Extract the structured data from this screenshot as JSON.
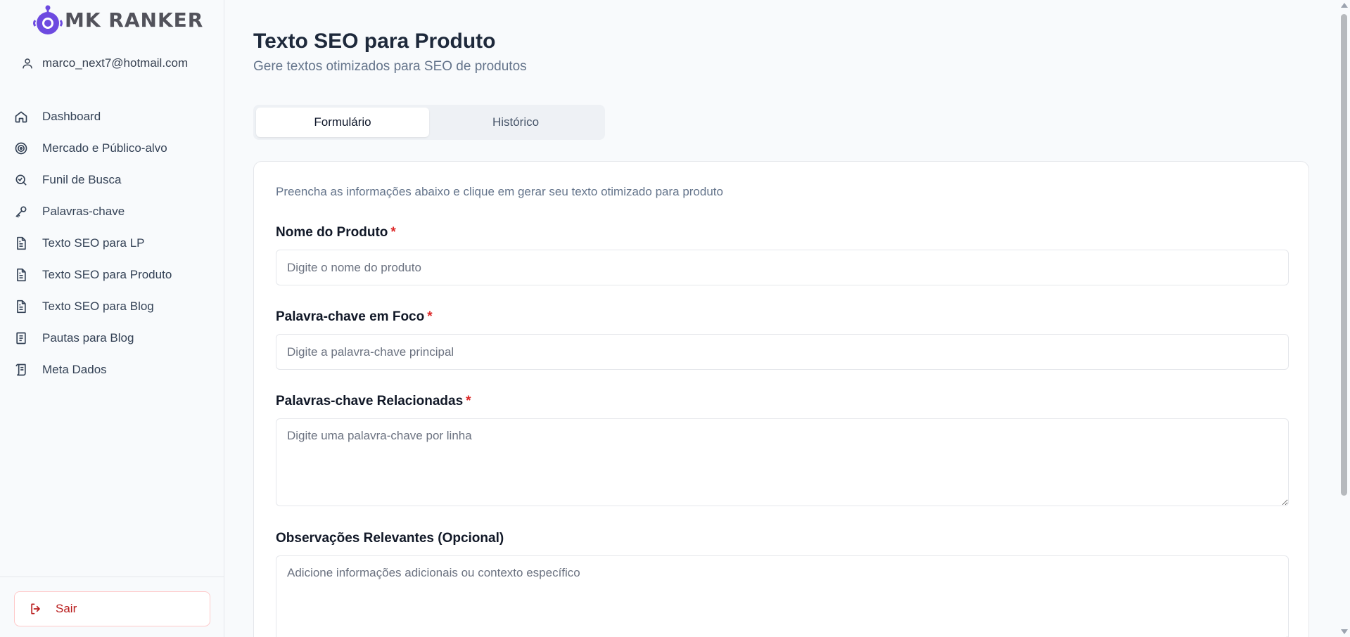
{
  "brand": {
    "name": "MK RANKER",
    "accent": "#6d4ae0"
  },
  "user": {
    "email": "marco_next7@hotmail.com",
    "icon": "user-icon"
  },
  "sidebar": {
    "items": [
      {
        "label": "Dashboard",
        "icon": "home-icon"
      },
      {
        "label": "Mercado e Público-alvo",
        "icon": "target-icon"
      },
      {
        "label": "Funil de Busca",
        "icon": "search-icon"
      },
      {
        "label": "Palavras-chave",
        "icon": "key-icon"
      },
      {
        "label": "Texto SEO para LP",
        "icon": "document-icon"
      },
      {
        "label": "Texto SEO para Produto",
        "icon": "document-icon"
      },
      {
        "label": "Texto SEO para Blog",
        "icon": "document-icon"
      },
      {
        "label": "Pautas para Blog",
        "icon": "notebook-icon"
      },
      {
        "label": "Meta Dados",
        "icon": "scroll-icon"
      }
    ],
    "logout_label": "Sair"
  },
  "page": {
    "title": "Texto SEO para Produto",
    "subtitle": "Gere textos otimizados para SEO de produtos"
  },
  "tabs": [
    {
      "label": "Formulário",
      "active": true
    },
    {
      "label": "Histórico",
      "active": false
    }
  ],
  "form": {
    "intro": "Preencha as informações abaixo e clique em gerar seu texto otimizado para produto",
    "required_mark": "*",
    "product_name": {
      "label": "Nome do Produto",
      "placeholder": "Digite o nome do produto",
      "value": ""
    },
    "focus_keyword": {
      "label": "Palavra-chave em Foco",
      "placeholder": "Digite a palavra-chave principal",
      "value": ""
    },
    "related_keywords": {
      "label": "Palavras-chave Relacionadas",
      "placeholder": "Digite uma palavra-chave por linha",
      "value": ""
    },
    "notes": {
      "label": "Observações Relevantes (Opcional)",
      "placeholder": "Adicione informações adicionais ou contexto específico",
      "value": ""
    }
  }
}
